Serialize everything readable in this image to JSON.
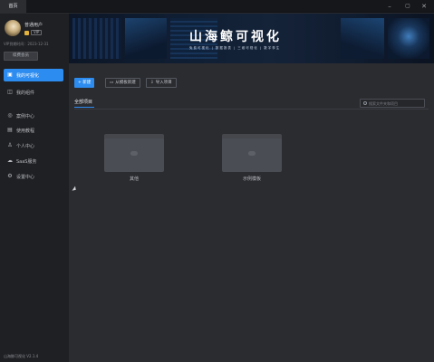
{
  "window": {
    "tag": "首页"
  },
  "user": {
    "name": "普通用户",
    "vip_label": "VIP",
    "expire": "VIP到期时间：2023-12-31",
    "renew": "续费会员"
  },
  "sidebar": {
    "items": [
      {
        "label": "我的可视化",
        "icon": "dashboard-icon",
        "active": true
      },
      {
        "label": "我的组件",
        "icon": "component-icon",
        "active": false
      },
      {
        "label": "案例中心",
        "icon": "case-icon",
        "active": false
      },
      {
        "label": "使用教程",
        "icon": "book-icon",
        "active": false
      },
      {
        "label": "个人中心",
        "icon": "user-icon",
        "active": false
      },
      {
        "label": "SaaS服务",
        "icon": "cloud-icon",
        "active": false
      },
      {
        "label": "设置中心",
        "icon": "gear-icon",
        "active": false
      }
    ],
    "version": "山海鲸可视化 V2.1.4"
  },
  "banner": {
    "title": "山海鲸可视化",
    "subtitle": "免费可视化  |  数据报表  |  三维可视化  |  数字孪生"
  },
  "toolbar": {
    "new": "+ 新建",
    "template": "从模板新建",
    "import": "导入项目"
  },
  "tabs": {
    "all": "全部项目"
  },
  "search": {
    "placeholder": "搜索文件夹和项目"
  },
  "folders": [
    {
      "label": "其他"
    },
    {
      "label": "示例模板"
    }
  ],
  "colors": {
    "accent": "#2d8cf0",
    "sidebar_bg": "#1f2023",
    "main_bg": "#2b2c30"
  }
}
